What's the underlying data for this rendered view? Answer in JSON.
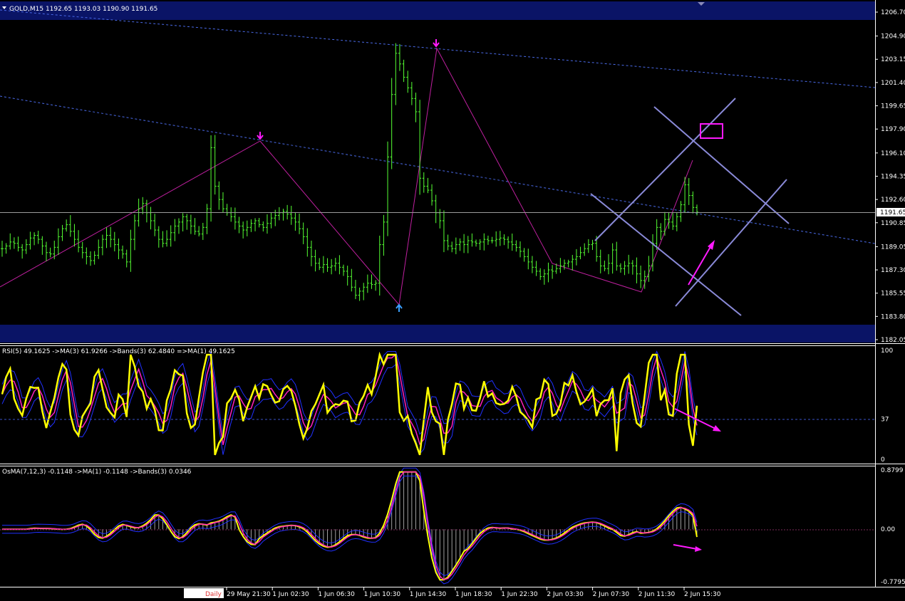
{
  "window": {
    "header": "GOLD,M15  1192.65 1193.03 1190.90 1191.65"
  },
  "colors": {
    "background": "#000000",
    "band": "#0a1466",
    "candle": "#55ff33",
    "zigzag": "#c020a0",
    "channel": "#4a6ae8",
    "gann": "#8a8ad8",
    "annotation": "#ff1aff",
    "arrow_up": "#3aa0ff",
    "rsi": "#ffff00",
    "rsi_ma": "#ff20c0",
    "bands": "#2030ff",
    "osma_hist": "#a0a0a0"
  },
  "chart_data": [
    {
      "type": "candlestick",
      "symbol": "GOLD",
      "timeframe": "M15",
      "ohlc_last": {
        "open": 1192.65,
        "high": 1193.03,
        "low": 1190.9,
        "close": 1191.65
      },
      "current_price": "1191.65",
      "ylim": [
        1182.05,
        1206.7
      ],
      "y_ticks": [
        "1206.70",
        "1204.90",
        "1203.15",
        "1201.40",
        "1199.65",
        "1197.90",
        "1196.10",
        "1194.35",
        "1192.60",
        "1190.85",
        "1189.05",
        "1187.30",
        "1185.55",
        "1183.80",
        "1182.05"
      ],
      "x_ticks": [
        "29 May 21:30",
        "1 Jun 02:30",
        "1 Jun 06:30",
        "1 Jun 10:30",
        "1 Jun 14:30",
        "1 Jun 18:30",
        "1 Jun 22:30",
        "2 Jun 03:30",
        "2 Jun 07:30",
        "2 Jun 11:30",
        "2 Jun 15:30"
      ],
      "period_label": "Daily",
      "close_series": [
        1188.9,
        1189.1,
        1189.4,
        1189.3,
        1189.0,
        1188.8,
        1189.2,
        1189.7,
        1189.9,
        1189.6,
        1189.1,
        1188.6,
        1188.5,
        1189.0,
        1189.8,
        1190.4,
        1190.7,
        1190.2,
        1189.6,
        1189.0,
        1188.6,
        1188.3,
        1188.0,
        1188.4,
        1189.0,
        1189.6,
        1189.9,
        1189.6,
        1189.2,
        1188.8,
        1188.5,
        1187.9,
        1189.6,
        1191.0,
        1191.9,
        1192.3,
        1191.6,
        1191.0,
        1190.3,
        1189.6,
        1189.3,
        1189.6,
        1190.1,
        1190.6,
        1190.9,
        1191.3,
        1191.0,
        1190.6,
        1190.2,
        1190.0,
        1190.5,
        1191.9,
        1196.5,
        1193.6,
        1192.6,
        1191.9,
        1191.6,
        1191.3,
        1190.9,
        1190.6,
        1190.3,
        1190.5,
        1190.8,
        1191.0,
        1190.7,
        1190.5,
        1190.8,
        1191.2,
        1191.4,
        1191.6,
        1191.7,
        1191.5,
        1191.2,
        1190.9,
        1190.4,
        1189.8,
        1189.0,
        1188.3,
        1187.8,
        1187.5,
        1187.7,
        1187.5,
        1187.6,
        1187.8,
        1187.5,
        1187.2,
        1186.8,
        1186.0,
        1185.4,
        1185.7,
        1186.0,
        1186.3,
        1186.2,
        1186.3,
        1189.2,
        1190.9,
        1195.8,
        1200.5,
        1203.6,
        1202.8,
        1201.8,
        1201.0,
        1200.2,
        1199.2,
        1194.2,
        1193.6,
        1193.3,
        1192.5,
        1191.6,
        1191.0,
        1189.5,
        1189.1,
        1188.9,
        1189.2,
        1189.4,
        1189.2,
        1189.5,
        1189.4,
        1189.3,
        1189.4,
        1189.6,
        1189.5,
        1189.5,
        1189.6,
        1189.7,
        1189.6,
        1189.4,
        1189.2,
        1189.0,
        1188.7,
        1188.3,
        1187.9,
        1187.5,
        1187.2,
        1186.8,
        1187.0,
        1187.3,
        1187.2,
        1187.4,
        1187.6,
        1187.8,
        1187.9,
        1188.1,
        1188.3,
        1188.6,
        1188.9,
        1189.2,
        1189.3,
        1188.3,
        1187.6,
        1187.4,
        1187.8,
        1188.8,
        1187.6,
        1187.4,
        1187.6,
        1187.8,
        1187.6,
        1187.0,
        1186.5,
        1186.8,
        1187.6,
        1189.3,
        1190.5,
        1190.2,
        1191.1,
        1190.9,
        1190.6,
        1191.3,
        1192.2,
        1193.7,
        1192.9,
        1192.0,
        1191.65
      ],
      "high_points": [
        {
          "time": "29 May 19:00",
          "price": 1196.9
        },
        {
          "time": "1 Jun 14:30",
          "price": 1203.9
        }
      ],
      "low_points": [
        {
          "time": "1 Jun 10:30",
          "price": 1184.4
        }
      ]
    },
    {
      "type": "line",
      "label": "RSI(5) 49.1625  ->MA(3) 61.9266  ->Bands(3) 62.4840  =>MA(1) 49.1625",
      "ylim": [
        0,
        100
      ],
      "y_ticks": [
        "100",
        "37",
        "0"
      ],
      "level": 37,
      "series": [
        {
          "name": "RSI(5)",
          "last": 49.1625
        },
        {
          "name": "MA(3)",
          "last": 61.9266
        },
        {
          "name": "Bands(3)",
          "last": 62.484
        }
      ]
    },
    {
      "type": "line",
      "label": "OsMA(7,12,3) -0.1148  ->MA(1) -0.1148  ->Bands(3) 0.0346",
      "ylim": [
        -0.7795,
        0.8799
      ],
      "y_ticks": [
        "0.8799",
        "0.00",
        "-0.7795"
      ],
      "series": [
        {
          "name": "OsMA(7,12,3)",
          "last": -0.1148
        },
        {
          "name": "MA(1)",
          "last": -0.1148
        },
        {
          "name": "Bands(3)",
          "last": 0.0346
        }
      ]
    }
  ]
}
